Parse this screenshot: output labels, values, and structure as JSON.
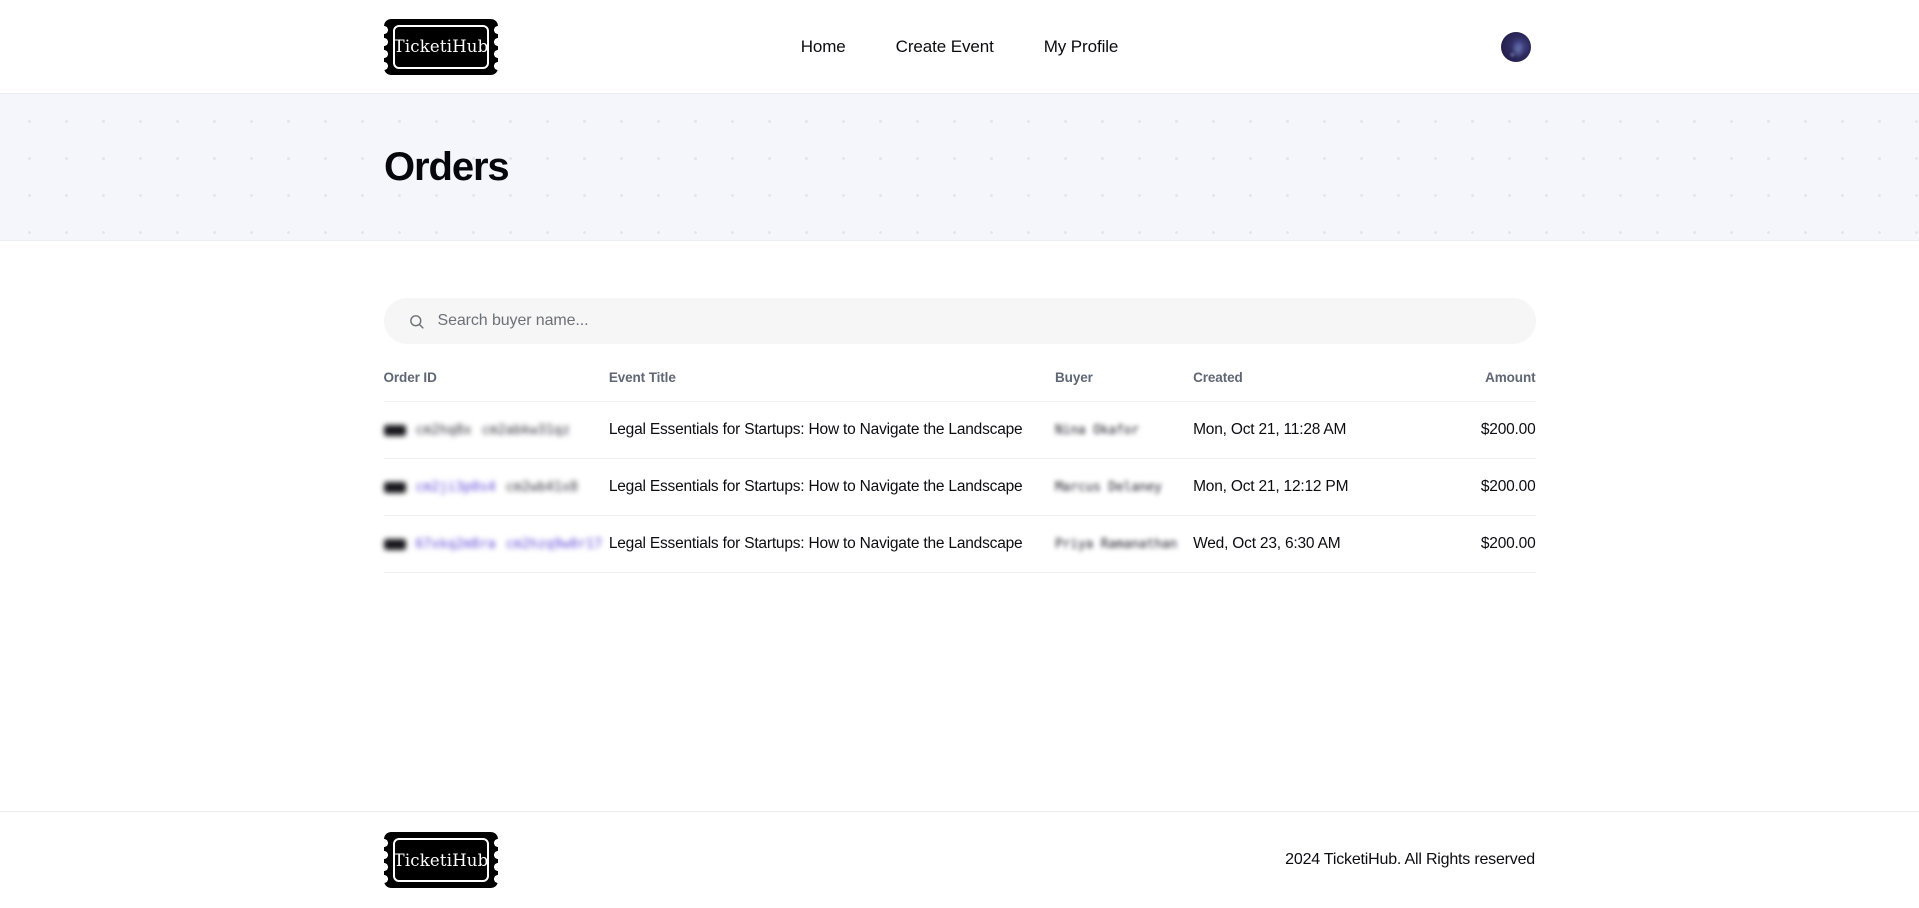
{
  "brand": {
    "name": "TicketiHub",
    "logo_icon": "ticket-icon"
  },
  "header": {
    "nav": [
      {
        "label": "Home",
        "name": "nav-home"
      },
      {
        "label": "Create Event",
        "name": "nav-create-event"
      },
      {
        "label": "My Profile",
        "name": "nav-my-profile"
      }
    ],
    "avatar_icon": "user-avatar"
  },
  "hero": {
    "title": "Orders"
  },
  "search": {
    "placeholder": "Search buyer name...",
    "value": "",
    "icon": "search-icon"
  },
  "table": {
    "columns": [
      {
        "key": "order_id",
        "label": "Order ID"
      },
      {
        "key": "event_title",
        "label": "Event Title"
      },
      {
        "key": "buyer",
        "label": "Buyer"
      },
      {
        "key": "created",
        "label": "Created"
      },
      {
        "key": "amount",
        "label": "Amount"
      }
    ],
    "rows": [
      {
        "order_id_part1": "cm2hq8x",
        "order_id_part2": "cm2abkw31qz",
        "order_id_tinted": false,
        "event_title": "Legal Essentials for Startups: How to Navigate the Landscape",
        "buyer": "Nina Okafor",
        "created": "Mon, Oct 21, 11:28 AM",
        "amount": "$200.00"
      },
      {
        "order_id_part1": "cm2ji3p0s4",
        "order_id_part2": "cm2wb41x8",
        "order_id_tinted": false,
        "event_title": "Legal Essentials for Startups: How to Navigate the Landscape",
        "buyer": "Marcus Delaney",
        "created": "Mon, Oct 21, 12:12 PM",
        "amount": "$200.00"
      },
      {
        "order_id_part1": "67xkq2m8ra",
        "order_id_part2": "cm2hzq9w0r17",
        "order_id_tinted": true,
        "event_title": "Legal Essentials for Startups: How to Navigate the Landscape",
        "buyer": "Priya Ramanathan",
        "created": "Wed, Oct 23, 6:30 AM",
        "amount": "$200.00"
      }
    ]
  },
  "footer": {
    "copyright": "2024 TicketiHub. All Rights reserved"
  },
  "colors": {
    "hero_background": "#f5f6fb",
    "hero_dot": "#e3e5ee",
    "search_background": "#f6f6f7",
    "table_border": "#eeeff2",
    "header_text": "#5f6674",
    "body_text": "#0c0c11"
  }
}
